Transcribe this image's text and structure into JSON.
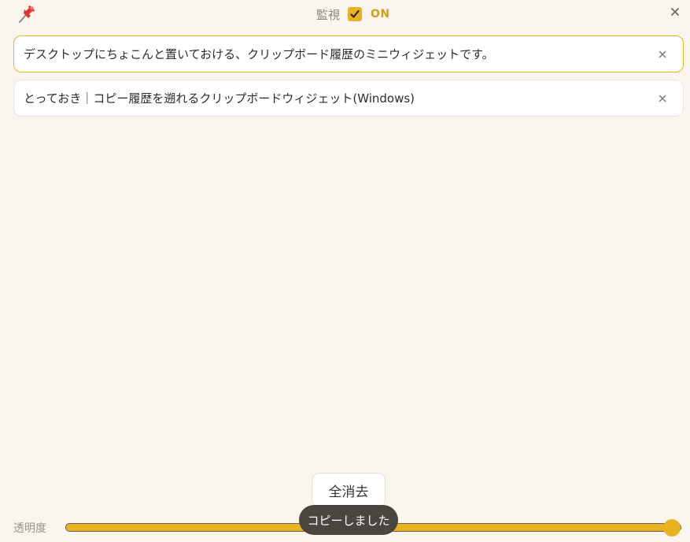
{
  "header": {
    "pin_icon": "pushpin-icon",
    "monitor_label": "監視",
    "monitor_checked": true,
    "on_label": "ON",
    "close_icon": "close-icon"
  },
  "history": {
    "items": [
      {
        "text": "デスクトップにちょこんと置いておける、クリップボード履歴のミニウィジェットです。",
        "selected": true
      },
      {
        "text": "とっておき｜コピー履歴を遡れるクリップボードウィジェット(Windows)",
        "selected": false
      }
    ]
  },
  "footer": {
    "clear_all_label": "全消去",
    "opacity_label": "透明度",
    "opacity_value": 1.0,
    "toast_text": "コピーしました"
  },
  "colors": {
    "accent": "#e9b31f",
    "background": "#faf5ef",
    "toast": "#4b4540"
  }
}
